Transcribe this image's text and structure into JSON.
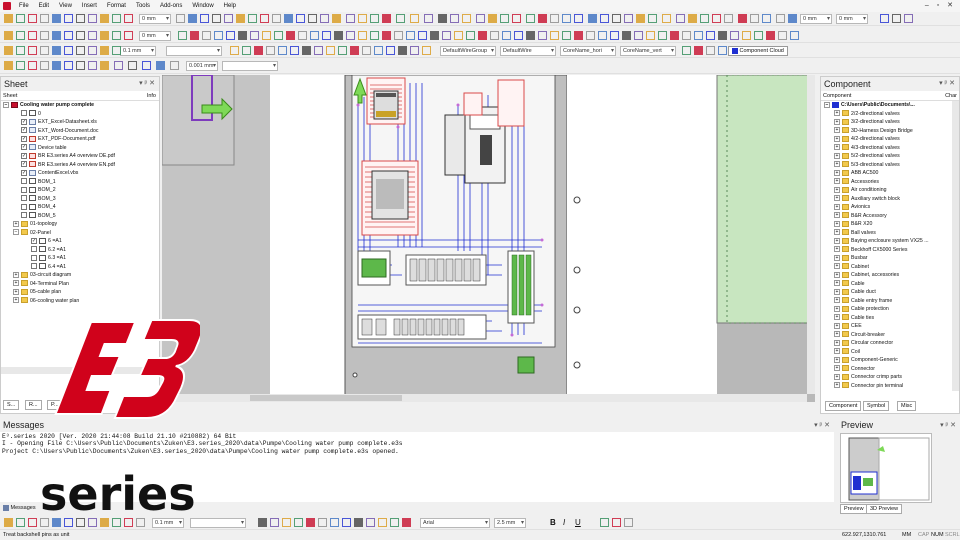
{
  "menu": [
    "File",
    "Edit",
    "View",
    "Insert",
    "Format",
    "Tools",
    "Add-ons",
    "Window",
    "Help"
  ],
  "window_controls": "– ▫ ✕",
  "toolbar": {
    "zoom_combo_1": "0 mm",
    "zoom_combo_2": "0 mm",
    "line_width": "0.1 mm",
    "text_height": "0.001 mm",
    "wire_group": "DefaultWireGroup",
    "wire_type": "DefaultWire",
    "core_name_hori": "CoreName_hori",
    "core_name_vert": "CoreName_vert",
    "component_cloud": "Component Cloud",
    "font_name": "Arial",
    "font_size": "2.5 mm",
    "bold": "B",
    "italic": "I",
    "underline": "U"
  },
  "sheet_panel": {
    "title": "Sheet",
    "col_left": "Sheet",
    "col_right": "Info",
    "items": [
      {
        "label": "Cooling water pump complete",
        "level": 0,
        "icon": "project",
        "bold": true
      },
      {
        "label": "0",
        "level": 1,
        "icon": "page",
        "check": false
      },
      {
        "label": "EXT_Excel-Datasheet.xls",
        "level": 1,
        "icon": "doc",
        "check": true
      },
      {
        "label": "EXT_Word-Document.doc",
        "level": 1,
        "icon": "doc",
        "check": true
      },
      {
        "label": "EXT_PDF-Document.pdf",
        "level": 1,
        "icon": "pdf",
        "check": true
      },
      {
        "label": "Device table",
        "level": 1,
        "icon": "doc",
        "check": true
      },
      {
        "label": "BR E3.series A4 overview DE.pdf",
        "level": 1,
        "icon": "pdf",
        "check": true
      },
      {
        "label": "BR E3.series A4 overview EN.pdf",
        "level": 1,
        "icon": "pdf",
        "check": true
      },
      {
        "label": "ContentExcel.vbs",
        "level": 1,
        "icon": "doc",
        "check": true
      },
      {
        "label": "BOM_1",
        "level": 1,
        "icon": "page",
        "check": false
      },
      {
        "label": "BOM_2",
        "level": 1,
        "icon": "page",
        "check": false
      },
      {
        "label": "BOM_3",
        "level": 1,
        "icon": "page",
        "check": false
      },
      {
        "label": "BOM_4",
        "level": 1,
        "icon": "page",
        "check": false
      },
      {
        "label": "BOM_5",
        "level": 1,
        "icon": "page",
        "check": false
      },
      {
        "label": "01-topology",
        "level": 1,
        "icon": "folder",
        "exp": "+"
      },
      {
        "label": "02-Panel",
        "level": 1,
        "icon": "folder",
        "exp": "−"
      },
      {
        "label": "6 =A1",
        "level": 2,
        "icon": "page",
        "check": true
      },
      {
        "label": "6.2 =A1",
        "level": 2,
        "icon": "page",
        "check": false
      },
      {
        "label": "6.3 =A1",
        "level": 2,
        "icon": "page",
        "check": false
      },
      {
        "label": "6.4 =A1",
        "level": 2,
        "icon": "page",
        "check": false
      },
      {
        "label": "03-circuit diagram",
        "level": 1,
        "icon": "folder",
        "exp": "+"
      },
      {
        "label": "04-Terminal Plan",
        "level": 1,
        "icon": "folder",
        "exp": "+"
      },
      {
        "label": "05-cable plan",
        "level": 1,
        "icon": "folder",
        "exp": "+"
      },
      {
        "label": "06-cooling water plan",
        "level": 1,
        "icon": "folder",
        "exp": "+"
      }
    ],
    "tabs": [
      "S...",
      "R...",
      "P..."
    ]
  },
  "component_panel": {
    "title": "Component",
    "col_left": "Component",
    "col_right": "Char",
    "root": "C:\\Users\\Public\\Documents\\...",
    "items": [
      "2/2-directional valves",
      "3/2-directional valves",
      "3D-Harness Design Bridge",
      "4/2-directional valves",
      "4/3-directional valves",
      "5/2-directional valves",
      "5/3-directional valves",
      "ABB AC500",
      "Accessories",
      "Air conditioning",
      "Auxiliary switch block",
      "Avionics",
      "B&R Accessory",
      "B&R X20",
      "Ball valves",
      "Baying enclosure system VX25 ...",
      "Beckhoff CX5000 Series",
      "Busbar",
      "Cabinet",
      "Cabinet, accessories",
      "Cable",
      "Cable duct",
      "Cable entry frame",
      "Cable protection",
      "Cable ties",
      "CEE",
      "Circuit-breaker",
      "Circular connector",
      "Coil",
      "Component-Generic",
      "Connector",
      "Connector crimp parts",
      "Connector pin terminal"
    ],
    "tabs": [
      "Component",
      "Symbol",
      "Misc"
    ]
  },
  "messages": {
    "title": "Messages",
    "lines": [
      "E³.series 2020 [Ver. 2020 21:44:08 Build 21.10 #210882) 64 Bit",
      "I - Opening File C:\\Users\\Public\\Documents\\Zuken\\E3.series_2020\\data\\Pumpe\\Cooling water pump complete.e3s",
      "Project C:\\Users\\Public\\Documents\\Zuken\\E3.series_2020\\data\\Pumpe\\Cooling water pump complete.e3s opened."
    ],
    "tab": "Messages"
  },
  "preview": {
    "title": "Preview",
    "tabs": [
      "Preview",
      "3D Preview"
    ]
  },
  "status": {
    "left": "Treat backshell pins as unit",
    "coords": "622.927,1310.761",
    "unit": "MM",
    "caps": "CAP",
    "num": "NUM",
    "scrl": "SCRL"
  },
  "logo": {
    "mark": "E3",
    "word": "series"
  },
  "colors": {
    "accent": "#c8102e",
    "wire": "#1f2fd1",
    "device_green": "#5db84a",
    "logo_red": "#d0021b"
  }
}
